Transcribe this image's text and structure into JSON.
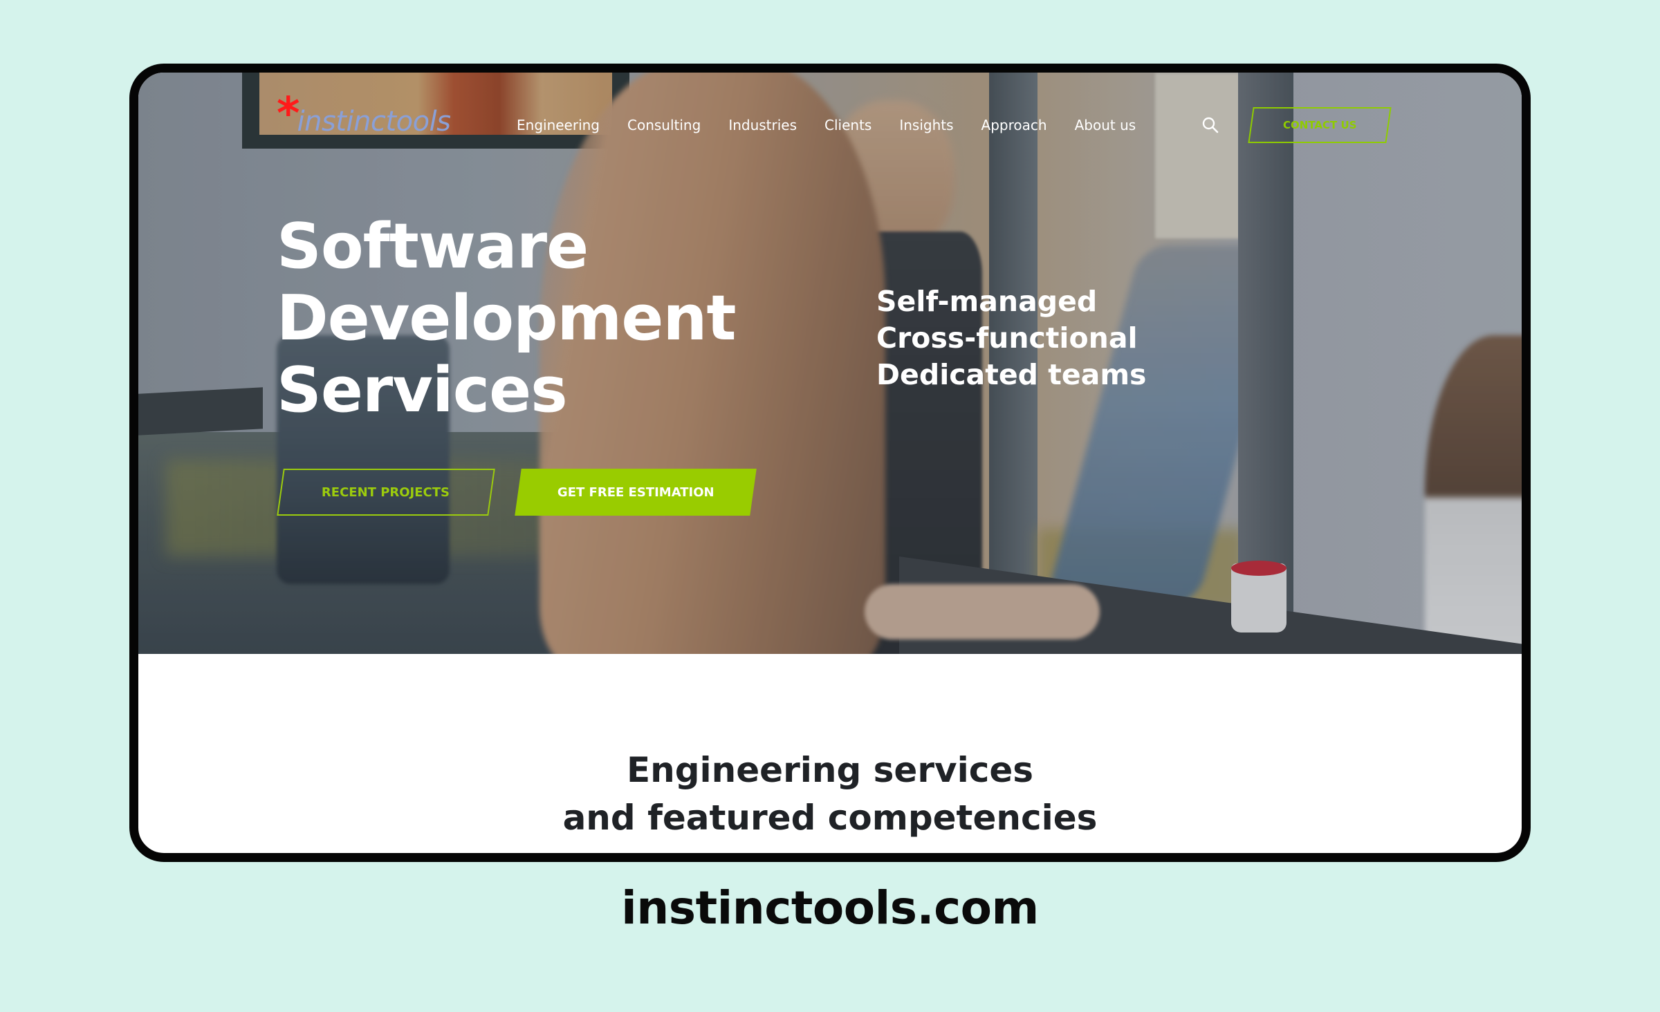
{
  "site": {
    "logo_text": "instinctools",
    "logo_mark": "*",
    "brand_color": "#99cc00",
    "logo_mark_color": "#ff1a1a"
  },
  "nav": {
    "items": [
      {
        "label": "Engineering"
      },
      {
        "label": "Consulting"
      },
      {
        "label": "Industries"
      },
      {
        "label": "Clients"
      },
      {
        "label": "Insights"
      },
      {
        "label": "Approach"
      },
      {
        "label": "About us"
      }
    ],
    "search_icon": "search-icon",
    "contact_label": "CONTACT US"
  },
  "hero": {
    "title_lines": [
      "Software",
      "Development",
      "Services"
    ],
    "subtitle_lines": [
      "Self-managed",
      "Cross-functional",
      "Dedicated teams"
    ],
    "primary_button": "GET FREE ESTIMATION",
    "secondary_button": "RECENT PROJECTS"
  },
  "section": {
    "title_lines": [
      "Engineering services",
      "and featured competencies"
    ]
  },
  "caption": "instinctools.com"
}
